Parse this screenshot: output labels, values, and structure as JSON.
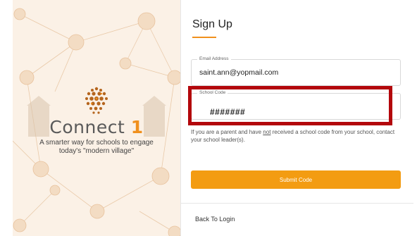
{
  "brand": {
    "name_text": "Connect",
    "name_number": "1",
    "tagline_line1": "A smarter way for schools to engage",
    "tagline_line2": "today's \"modern village\"",
    "logo_icon": "dotted-globe-icon",
    "accent_color": "#f0901d"
  },
  "form": {
    "title": "Sign Up",
    "email": {
      "label": "Email Address",
      "value": "saint.ann@yopmail.com"
    },
    "school_code": {
      "label": "School Code",
      "value": "#######"
    },
    "help_before": "If you are a parent and have ",
    "help_not": "not",
    "help_after": " received a school code from your school, contact your school leader(s).",
    "submit_label": "Submit Code",
    "submit_color": "#f39c12",
    "back_label": "Back To Login",
    "highlight_color": "#b3070c"
  }
}
